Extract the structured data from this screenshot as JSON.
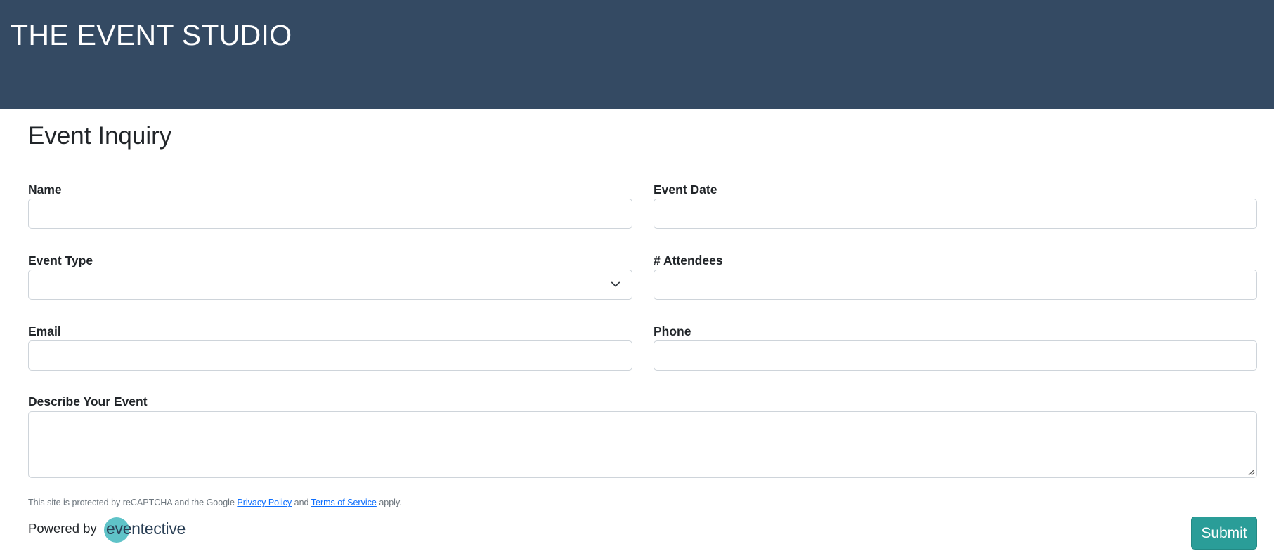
{
  "header": {
    "title": "THE EVENT STUDIO"
  },
  "form": {
    "title": "Event Inquiry",
    "fields": {
      "name": {
        "label": "Name",
        "value": "",
        "placeholder": ""
      },
      "event_date": {
        "label": "Event Date",
        "value": "",
        "placeholder": ""
      },
      "event_type": {
        "label": "Event Type",
        "selected": ""
      },
      "attendees": {
        "label": "# Attendees",
        "value": "",
        "placeholder": ""
      },
      "email": {
        "label": "Email",
        "value": "",
        "placeholder": ""
      },
      "phone": {
        "label": "Phone",
        "value": "",
        "placeholder": ""
      },
      "description": {
        "label": "Describe Your Event",
        "value": ""
      }
    },
    "recaptcha": {
      "prefix": "This site is protected by reCAPTCHA and the Google ",
      "privacy_link": "Privacy Policy",
      "and": " and ",
      "terms_link": "Terms of Service",
      "suffix": " apply."
    },
    "submit_label": "Submit"
  },
  "footer": {
    "powered_by": "Powered by",
    "logo_text": "eventective"
  },
  "colors": {
    "header_bg": "#344a63",
    "submit_bg": "#2a9d98",
    "logo_circle": "#5fc3c8"
  },
  "icons": {
    "select_chevron": "chevron-down-icon",
    "resize_grip": "resize-grip-icon"
  }
}
